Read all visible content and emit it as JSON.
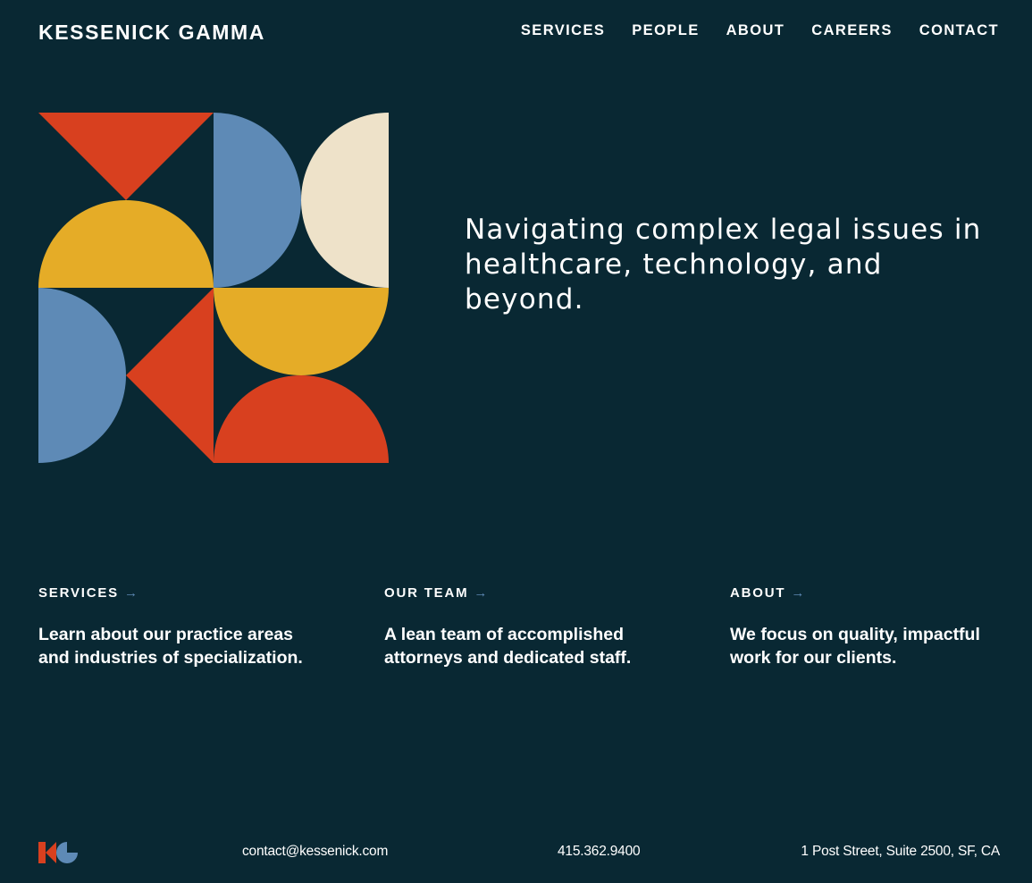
{
  "header": {
    "brand": "KESSENICK GAMMA",
    "nav": [
      "SERVICES",
      "PEOPLE",
      "ABOUT",
      "CAREERS",
      "CONTACT"
    ]
  },
  "hero": {
    "tagline": "Navigating complex legal issues in healthcare, technology, and beyond.",
    "art_colors": {
      "red": "#d8401f",
      "blue": "#5e8ab6",
      "yellow": "#e5ac27",
      "cream": "#eee2c9"
    }
  },
  "cards": [
    {
      "title": "SERVICES",
      "arrow": "→",
      "description": "Learn about our practice areas and industries of specialization."
    },
    {
      "title": "OUR TEAM",
      "arrow": "→",
      "description": "A lean team of accomplished attorneys and dedicated staff."
    },
    {
      "title": "ABOUT",
      "arrow": "→",
      "description": "We focus on quality, impactful work for our clients."
    }
  ],
  "footer": {
    "email": "contact@kessenick.com",
    "phone": "415.362.9400",
    "address": "1 Post Street, Suite 2500, SF, CA"
  },
  "theme": {
    "background": "#092833",
    "text": "#ffffff",
    "accent": "#5e8ab6"
  }
}
